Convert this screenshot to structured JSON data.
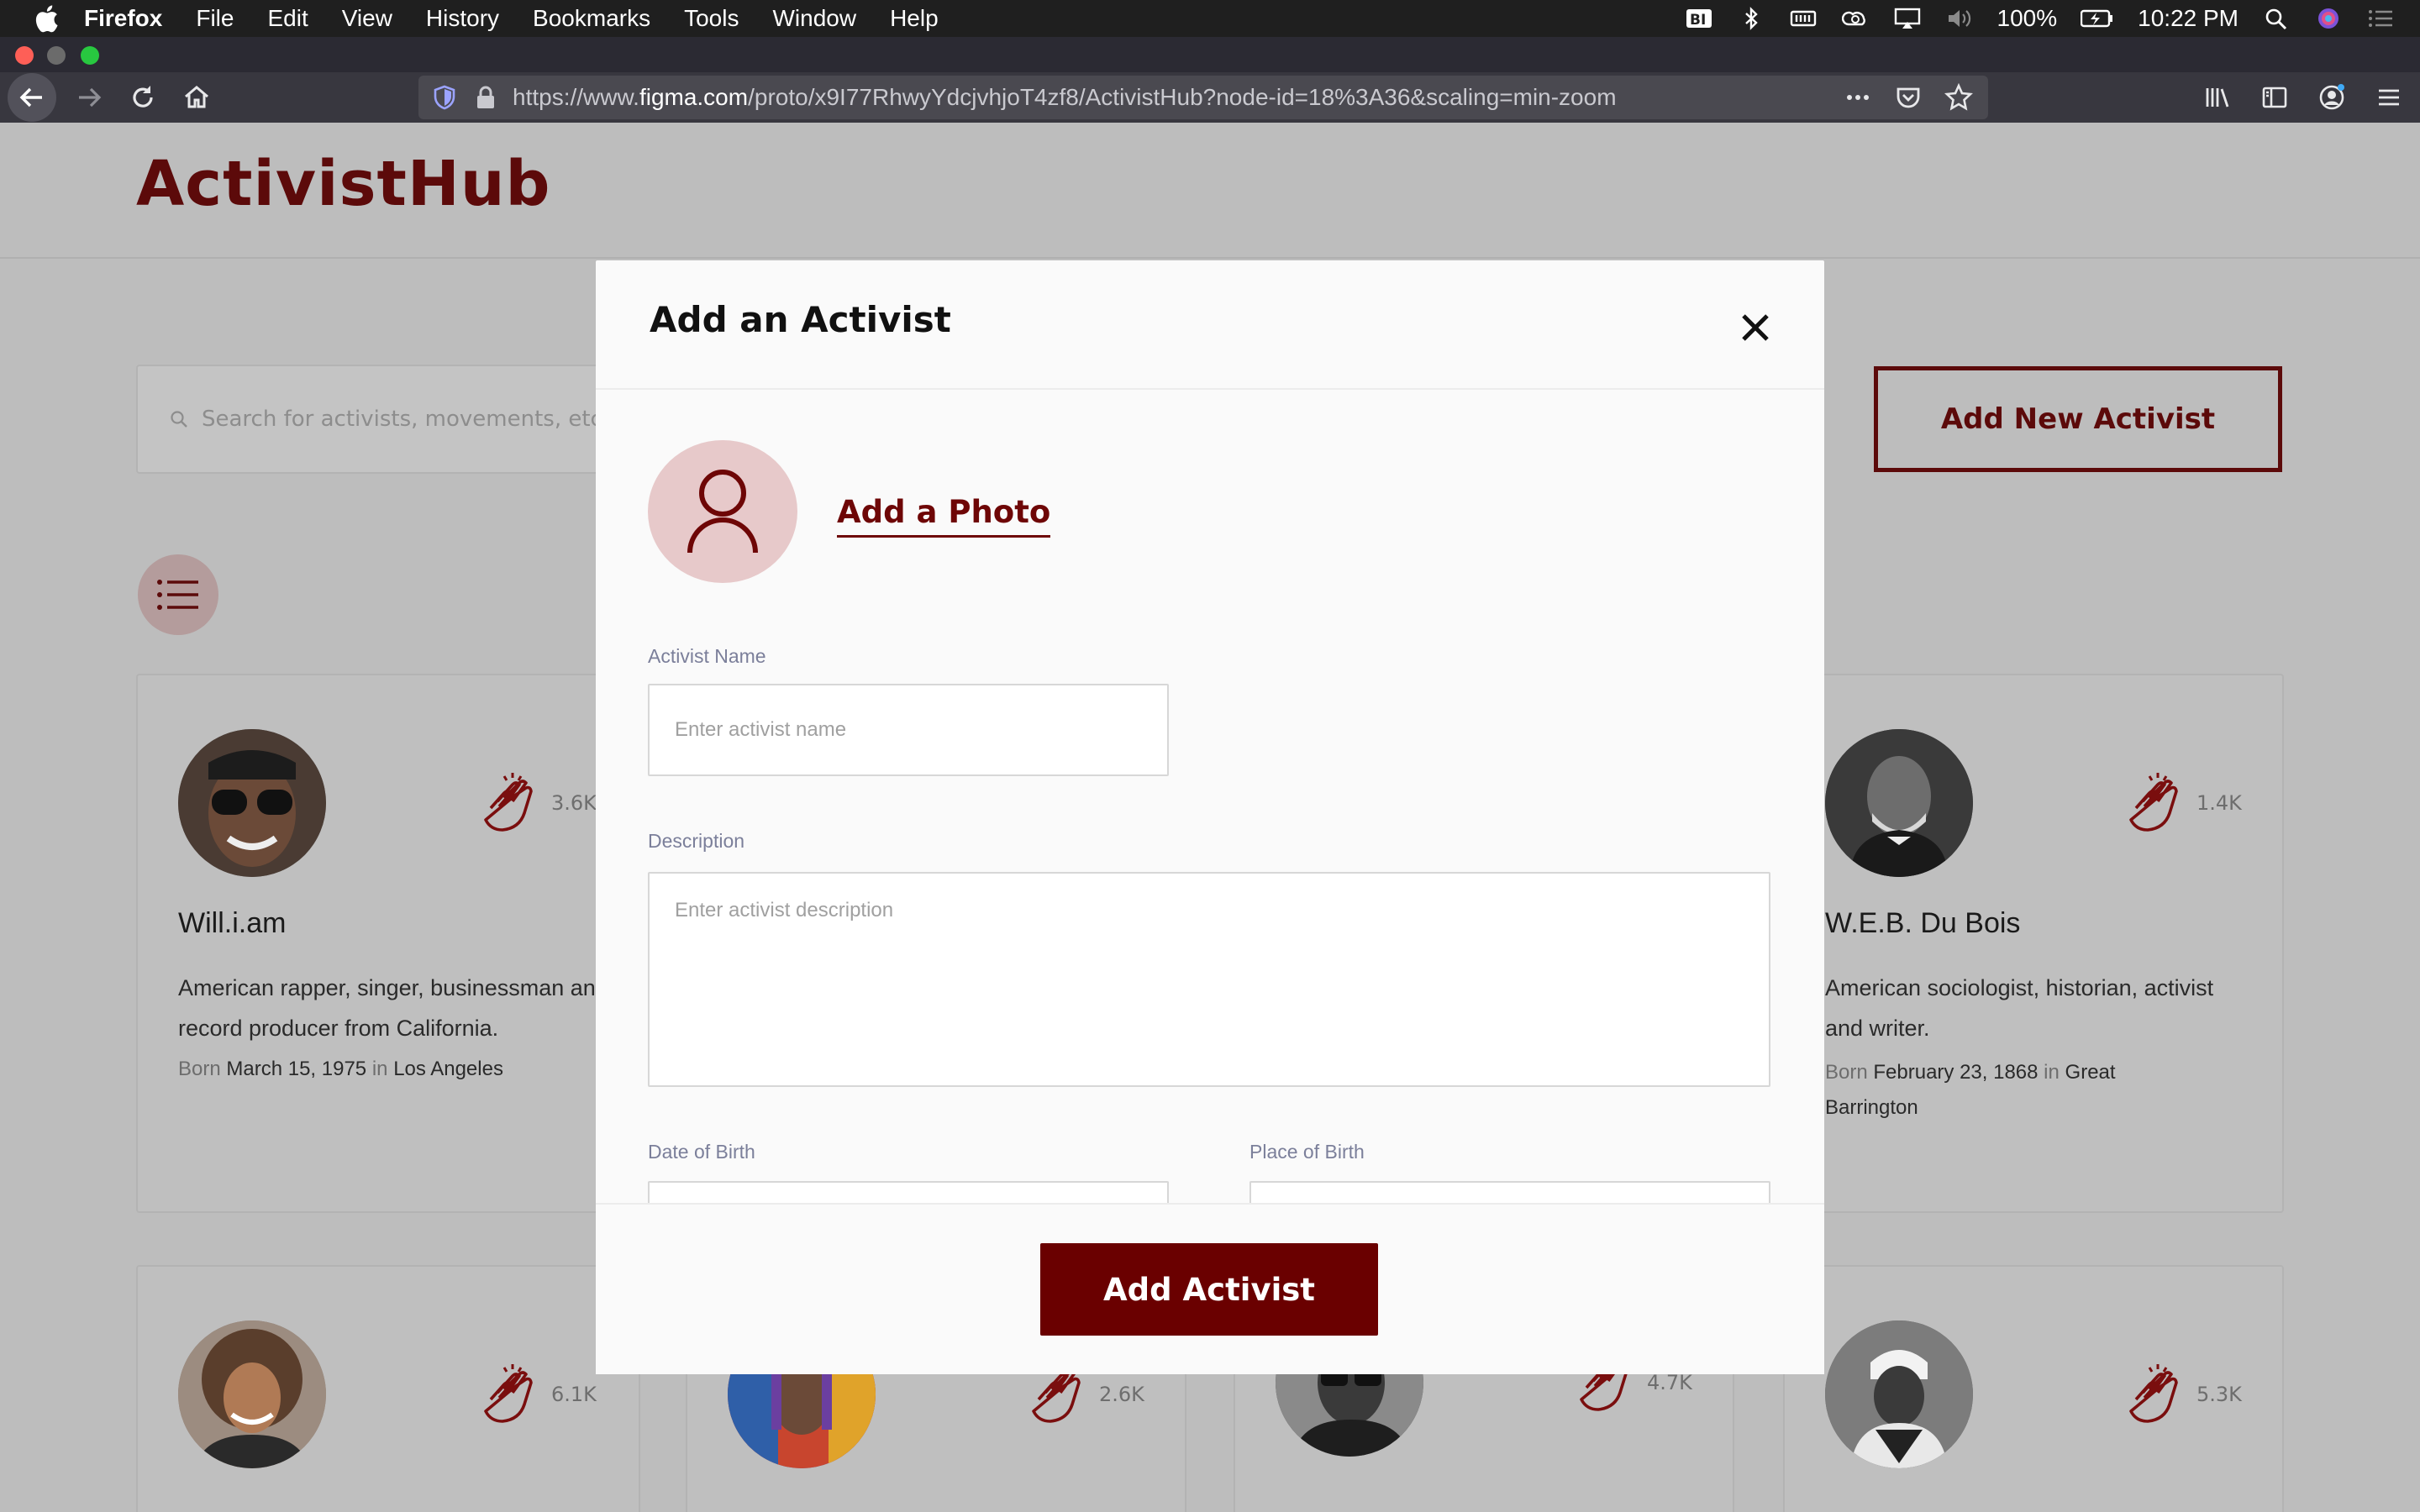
{
  "menubar": {
    "app_name": "Firefox",
    "menus": [
      "File",
      "Edit",
      "View",
      "History",
      "Bookmarks",
      "Tools",
      "Window",
      "Help"
    ],
    "battery": "100%",
    "time": "10:22 PM"
  },
  "browser": {
    "url_prefix": "https://www.",
    "url_host": "figma.com",
    "url_path": "/proto/x9I77RhwyYdcjvhjoT4zf8/ActivistHub?node-id=18%3A36&scaling=min-zoom"
  },
  "site": {
    "logo": "ActivistHub",
    "search_placeholder": "Search for activists, movements, etc",
    "add_new_label": "Add New Activist"
  },
  "cards": [
    {
      "name": "Will.i.am",
      "claps": "3.6K",
      "description": "American rapper, singer, businessman and record producer from California.",
      "born_prefix": "Born",
      "born_date": "March 15, 1975",
      "born_in": "in",
      "born_place": "Los Angeles"
    },
    {
      "name": "W.E.B. Du Bois",
      "claps": "1.4K",
      "description": "American sociologist, historian, activist and writer.",
      "born_prefix": "Born",
      "born_date": "February 23, 1868",
      "born_in": "in",
      "born_place": "Great Barrington"
    },
    {
      "claps": "6.1K"
    },
    {
      "claps": "2.6K"
    },
    {
      "claps": "4.7K"
    },
    {
      "claps": "5.3K"
    }
  ],
  "modal": {
    "title": "Add an Activist",
    "add_photo_label": "Add a Photo",
    "name_label": "Activist Name",
    "name_placeholder": "Enter activist name",
    "description_label": "Description",
    "description_placeholder": "Enter activist description",
    "dob_label": "Date of Birth",
    "pob_label": "Place of Birth",
    "submit_label": "Add Activist"
  },
  "colors": {
    "brand": "#6a0000",
    "photo_bg": "#e7c9ca",
    "overlay": "#bdbdbd"
  }
}
